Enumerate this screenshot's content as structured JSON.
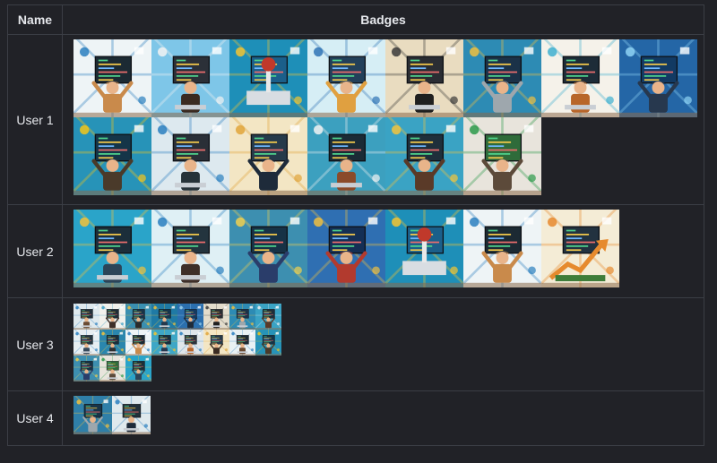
{
  "table": {
    "headers": {
      "name": "Name",
      "badges": "Badges"
    },
    "rows": [
      {
        "name": "User 1",
        "size": "large",
        "badges": [
          {
            "bg": "#eef4f6",
            "accent": "#2a7fbf",
            "screen": "#1c2a33",
            "figure": "#c98a4b",
            "motif": "arms"
          },
          {
            "bg": "#7ec6e8",
            "accent": "#f2f2f2",
            "screen": "#2b3038",
            "figure": "#3a2a20",
            "motif": "laptop"
          },
          {
            "bg": "#1e8fb8",
            "accent": "#f4c430",
            "screen": "#1b5f8a",
            "figure": "#c0392b",
            "motif": "joystick"
          },
          {
            "bg": "#d6eef5",
            "accent": "#2f73b5",
            "screen": "#23405a",
            "figure": "#e0a040",
            "motif": "arms"
          },
          {
            "bg": "#e9dcc0",
            "accent": "#3a3a3a",
            "screen": "#2a2d33",
            "figure": "#1f1f1f",
            "motif": "person"
          },
          {
            "bg": "#2d8bb4",
            "accent": "#f0c040",
            "screen": "#1b3248",
            "figure": "#9ea7ad",
            "motif": "arms"
          },
          {
            "bg": "#f5f2ea",
            "accent": "#3fb0d0",
            "screen": "#1d2c38",
            "figure": "#b8662a",
            "motif": "person"
          },
          {
            "bg": "#2466a6",
            "accent": "#8fd3f4",
            "screen": "#123a63",
            "figure": "#27384e",
            "motif": "arms"
          },
          {
            "bg": "#2793b8",
            "accent": "#f5c518",
            "screen": "#153548",
            "figure": "#4a3a2a",
            "motif": "arms"
          },
          {
            "bg": "#dde9ef",
            "accent": "#2a7fbf",
            "screen": "#2a2f37",
            "figure": "#263238",
            "motif": "person"
          },
          {
            "bg": "#f3e6c4",
            "accent": "#e0a43a",
            "screen": "#263a4a",
            "figure": "#1e2b3a",
            "motif": "arms"
          },
          {
            "bg": "#3ca0bf",
            "accent": "#f2f2f2",
            "screen": "#1b2b36",
            "figure": "#8b4b2a",
            "motif": "person"
          },
          {
            "bg": "#3aa3c4",
            "accent": "#f3c43c",
            "screen": "#1f2f3b",
            "figure": "#5a3a28",
            "motif": "arms"
          },
          {
            "bg": "#e8e4dc",
            "accent": "#2c9a4a",
            "screen": "#2f6b3a",
            "figure": "#5c4a3a",
            "motif": "arms"
          }
        ]
      },
      {
        "name": "User 2",
        "size": "large",
        "badges": [
          {
            "bg": "#2aa4c9",
            "accent": "#f2c23a",
            "screen": "#1c2e3a",
            "figure": "#2c4458",
            "motif": "person"
          },
          {
            "bg": "#dff0f5",
            "accent": "#2a7fbf",
            "screen": "#23343e",
            "figure": "#3e2f28",
            "motif": "person"
          },
          {
            "bg": "#3d8fb0",
            "accent": "#f0d050",
            "screen": "#173246",
            "figure": "#2a3d6a",
            "motif": "arms"
          },
          {
            "bg": "#2f6fb2",
            "accent": "#f0c040",
            "screen": "#142f55",
            "figure": "#b23a2e",
            "motif": "arms"
          },
          {
            "bg": "#1e8fb8",
            "accent": "#f4c430",
            "screen": "#1b5f8a",
            "figure": "#c0392b",
            "motif": "joystick"
          },
          {
            "bg": "#eef4f6",
            "accent": "#2a7fbf",
            "screen": "#1c2a33",
            "figure": "#c98a4b",
            "motif": "arms"
          },
          {
            "bg": "#f4ecd6",
            "accent": "#e68a2e",
            "screen": "#223240",
            "figure": "#3f7d3a",
            "motif": "arrow"
          }
        ]
      },
      {
        "name": "User 3",
        "size": "small",
        "badges": [
          {
            "bg": "#dfe9ed",
            "accent": "#2a7fbf",
            "screen": "#22303a",
            "figure": "#6a4a32",
            "motif": "person"
          },
          {
            "bg": "#f1f1ec",
            "accent": "#3a9ec4",
            "screen": "#1f2d36",
            "figure": "#3e2f28",
            "motif": "arms"
          },
          {
            "bg": "#3a8fb0",
            "accent": "#f0c040",
            "screen": "#183448",
            "figure": "#2b2b2b",
            "motif": "arms"
          },
          {
            "bg": "#1f7aa5",
            "accent": "#f2c23a",
            "screen": "#16364c",
            "figure": "#26394d",
            "motif": "person"
          },
          {
            "bg": "#2b6fae",
            "accent": "#9fd4ef",
            "screen": "#143a60",
            "figure": "#1e2b3a",
            "motif": "arms"
          },
          {
            "bg": "#e3dccb",
            "accent": "#3a3a3a",
            "screen": "#2a2d33",
            "figure": "#1f1f1f",
            "motif": "person"
          },
          {
            "bg": "#2d8bb4",
            "accent": "#f0c040",
            "screen": "#1b3248",
            "figure": "#9ea7ad",
            "motif": "person"
          },
          {
            "bg": "#3aa3c4",
            "accent": "#f2f2f2",
            "screen": "#1f2f3b",
            "figure": "#5a3a28",
            "motif": "arms"
          },
          {
            "bg": "#e6eef2",
            "accent": "#2a7fbf",
            "screen": "#253742",
            "figure": "#364a5c",
            "motif": "person"
          },
          {
            "bg": "#2a86ad",
            "accent": "#f3c43c",
            "screen": "#1a2e3b",
            "figure": "#2f2f2f",
            "motif": "person"
          },
          {
            "bg": "#eef4f6",
            "accent": "#2a7fbf",
            "screen": "#1c2a33",
            "figure": "#c98a4b",
            "motif": "arms"
          },
          {
            "bg": "#3ea7c6",
            "accent": "#f4c430",
            "screen": "#182f3e",
            "figure": "#27384e",
            "motif": "person"
          },
          {
            "bg": "#dfe6ea",
            "accent": "#2a7fbf",
            "screen": "#2b333b",
            "figure": "#b8662a",
            "motif": "person"
          },
          {
            "bg": "#f3e6c4",
            "accent": "#e0a43a",
            "screen": "#263a4a",
            "figure": "#3c2c22",
            "motif": "arms"
          },
          {
            "bg": "#e9f1f4",
            "accent": "#2a7fbf",
            "screen": "#1c2a33",
            "figure": "#6a4a32",
            "motif": "person"
          },
          {
            "bg": "#2793b8",
            "accent": "#f5c518",
            "screen": "#153548",
            "figure": "#4a3a2a",
            "motif": "arms"
          },
          {
            "bg": "#3d8fb0",
            "accent": "#f0d050",
            "screen": "#173246",
            "figure": "#2a3d6a",
            "motif": "arms"
          },
          {
            "bg": "#e8e4dc",
            "accent": "#2c9a4a",
            "screen": "#2f6b3a",
            "figure": "#5c4a3a",
            "motif": "person"
          },
          {
            "bg": "#2aa4c9",
            "accent": "#f2c23a",
            "screen": "#1c2e3a",
            "figure": "#2c4458",
            "motif": "arms"
          }
        ]
      },
      {
        "name": "User 4",
        "size": "tiny",
        "badges": [
          {
            "bg": "#2f7fa8",
            "accent": "#f0c040",
            "screen": "#183448",
            "figure": "#9ea7ad",
            "motif": "arms"
          },
          {
            "bg": "#dfe9ed",
            "accent": "#2a7fbf",
            "screen": "#22303a",
            "figure": "#1e2b3a",
            "motif": "person"
          }
        ]
      }
    ]
  }
}
